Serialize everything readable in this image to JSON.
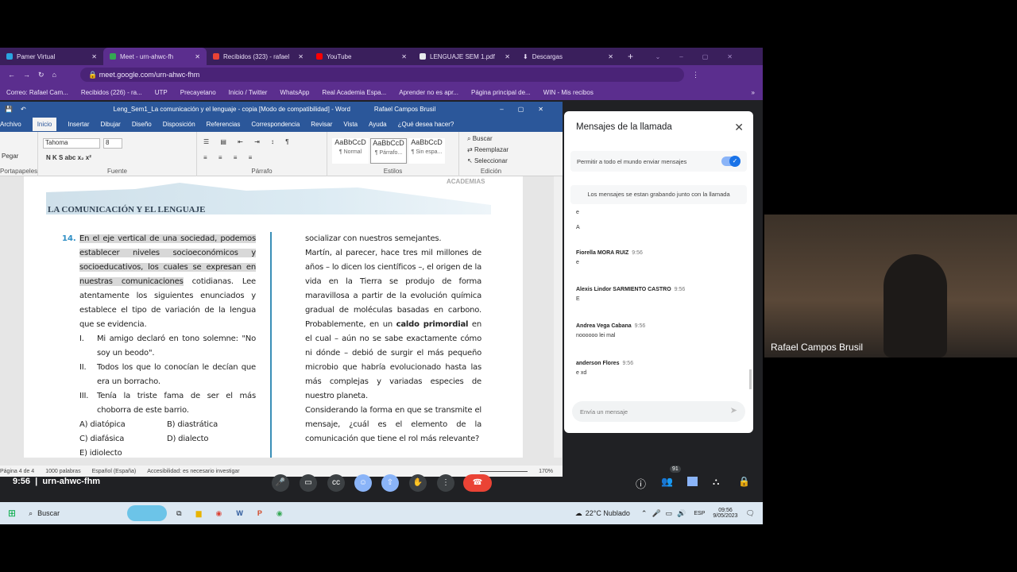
{
  "browser": {
    "tabs": [
      {
        "label": "Pamer Virtual",
        "color": "#2aa5e0"
      },
      {
        "label": "Meet - urn-ahwc-fh",
        "color": "#34a853",
        "active": true
      },
      {
        "label": "Recibidos (323) - rafael",
        "color": "#ea4335"
      },
      {
        "label": "YouTube",
        "color": "#ff0000"
      },
      {
        "label": "LENGUAJE SEM 1.pdf",
        "color": "#e8eaed"
      },
      {
        "label": "Descargas",
        "color": "#e8eaed"
      }
    ],
    "new_tab": "+",
    "url": "meet.google.com/urn-ahwc-fhm",
    "bookmarks": [
      "Correo: Rafael Cam...",
      "Recibidos (226) - ra...",
      "UTP",
      "Precayetano",
      "Inicio / Twitter",
      "WhatsApp",
      "Real Academia Espa...",
      "Aprender no es apr...",
      "Página principal de...",
      "WIN - Mis recibos"
    ],
    "bookmarks_more": "»"
  },
  "word": {
    "title": "Leng_Sem1_La comunicación y el lenguaje - copia [Modo de compatibilidad] - Word",
    "user": "Rafael Campos Brusil",
    "tabs": [
      "Archivo",
      "Inicio",
      "Insertar",
      "Dibujar",
      "Diseño",
      "Disposición",
      "Referencias",
      "Correspondencia",
      "Revisar",
      "Vista",
      "Ayuda",
      "¿Qué desea hacer?"
    ],
    "font": "Tahoma",
    "size": "8",
    "groups": {
      "clipboard": "Portapapeles",
      "font": "Fuente",
      "paragraph": "Párrafo",
      "styles": "Estilos",
      "edit": "Edición"
    },
    "paste": "Pegar",
    "format_buttons": "N  K  S  abc  x₂  x²",
    "styles": [
      {
        "sample": "AaBbCcD",
        "name": "¶ Normal"
      },
      {
        "sample": "AaBbCcD",
        "name": "¶ Párrafo..."
      },
      {
        "sample": "AaBbCcD",
        "name": "¶ Sin espa..."
      }
    ],
    "edit": [
      "Buscar",
      "Reemplazar",
      "Seleccionar"
    ],
    "status": {
      "page": "Página 4 de 4",
      "words": "1000 palabras",
      "lang": "Español (España)",
      "access": "Accesibilidad: es necesario investigar",
      "zoom": "170%"
    }
  },
  "document": {
    "section_title": "LA COMUNICACIÓN Y EL LENGUAJE",
    "logo": "Pamer ACADEMIAS",
    "q_number": "14.",
    "q_hl": "En el eje vertical de una sociedad, podemos establecer niveles socioeconómicos y socioeducativos, los cuales se expresan en nuestras comunicaciones",
    "q_rest": " cotidianas. Lee atentamente los siguientes enunciados y establece el tipo de variación de la lengua que se evidencia.",
    "items": [
      {
        "n": "I.",
        "text": "Mi amigo declaró en tono solemne: \"No soy un beodo\"."
      },
      {
        "n": "II.",
        "text": "Todos los que lo conocían le decían que era un borracho."
      },
      {
        "n": "III.",
        "text": "Tenía la triste fama de ser el más choborra de este barrio."
      }
    ],
    "options": [
      "A) diatópica",
      "B) diastrática",
      "C) diafásica",
      "D) dialecto",
      "E) idiolecto"
    ],
    "right_1": "socializar con nuestros semejantes.",
    "right_2": "Martín, al parecer, hace tres mil millones de años – lo dicen los científicos –, el origen de la vida en la Tierra se produjo de forma maravillosa a partir de la evolución química gradual de moléculas basadas en carbono. Probablemente, en un ",
    "right_bold": "caldo primordial",
    "right_3": " en el cual – aún no se sabe exactamente cómo ni dónde – debió de surgir el más pequeño microbio que habría evolucionado hasta las más complejas y variadas especies de nuestro planeta.",
    "right_4": "Considerando la forma en que se transmite el mensaje, ¿cuál es el elemento de la comunicación que tiene el rol más relevante?"
  },
  "chat": {
    "title": "Mensajes de la llamada",
    "permit": "Permitir a todo el mundo enviar mensajes",
    "permit_on": true,
    "recording": "Los mensajes se estan grabando junto con la llamada",
    "orphan": [
      "e",
      "A"
    ],
    "messages": [
      {
        "name": "Fiorella MORA RUIZ",
        "time": "9:56",
        "text": "e"
      },
      {
        "name": "Alexis Lindor SARMIENTO CASTRO",
        "time": "9:56",
        "text": "E"
      },
      {
        "name": "Andrea Vega Cabana",
        "time": "9:56",
        "text": "noooooo lei mal"
      },
      {
        "name": "anderson Flores",
        "time": "9:56",
        "text": "e xd"
      }
    ],
    "placeholder": "Envía un mensaje"
  },
  "video": {
    "name": "Rafael Campos Brusil"
  },
  "meet": {
    "time": "9:56",
    "code": "urn-ahwc-fhm",
    "participants": "91"
  },
  "taskbar": {
    "search": "Buscar",
    "weather": "22°C  Nublado",
    "lang": "ESP",
    "time": "09:56",
    "date": "9/05/2023"
  }
}
